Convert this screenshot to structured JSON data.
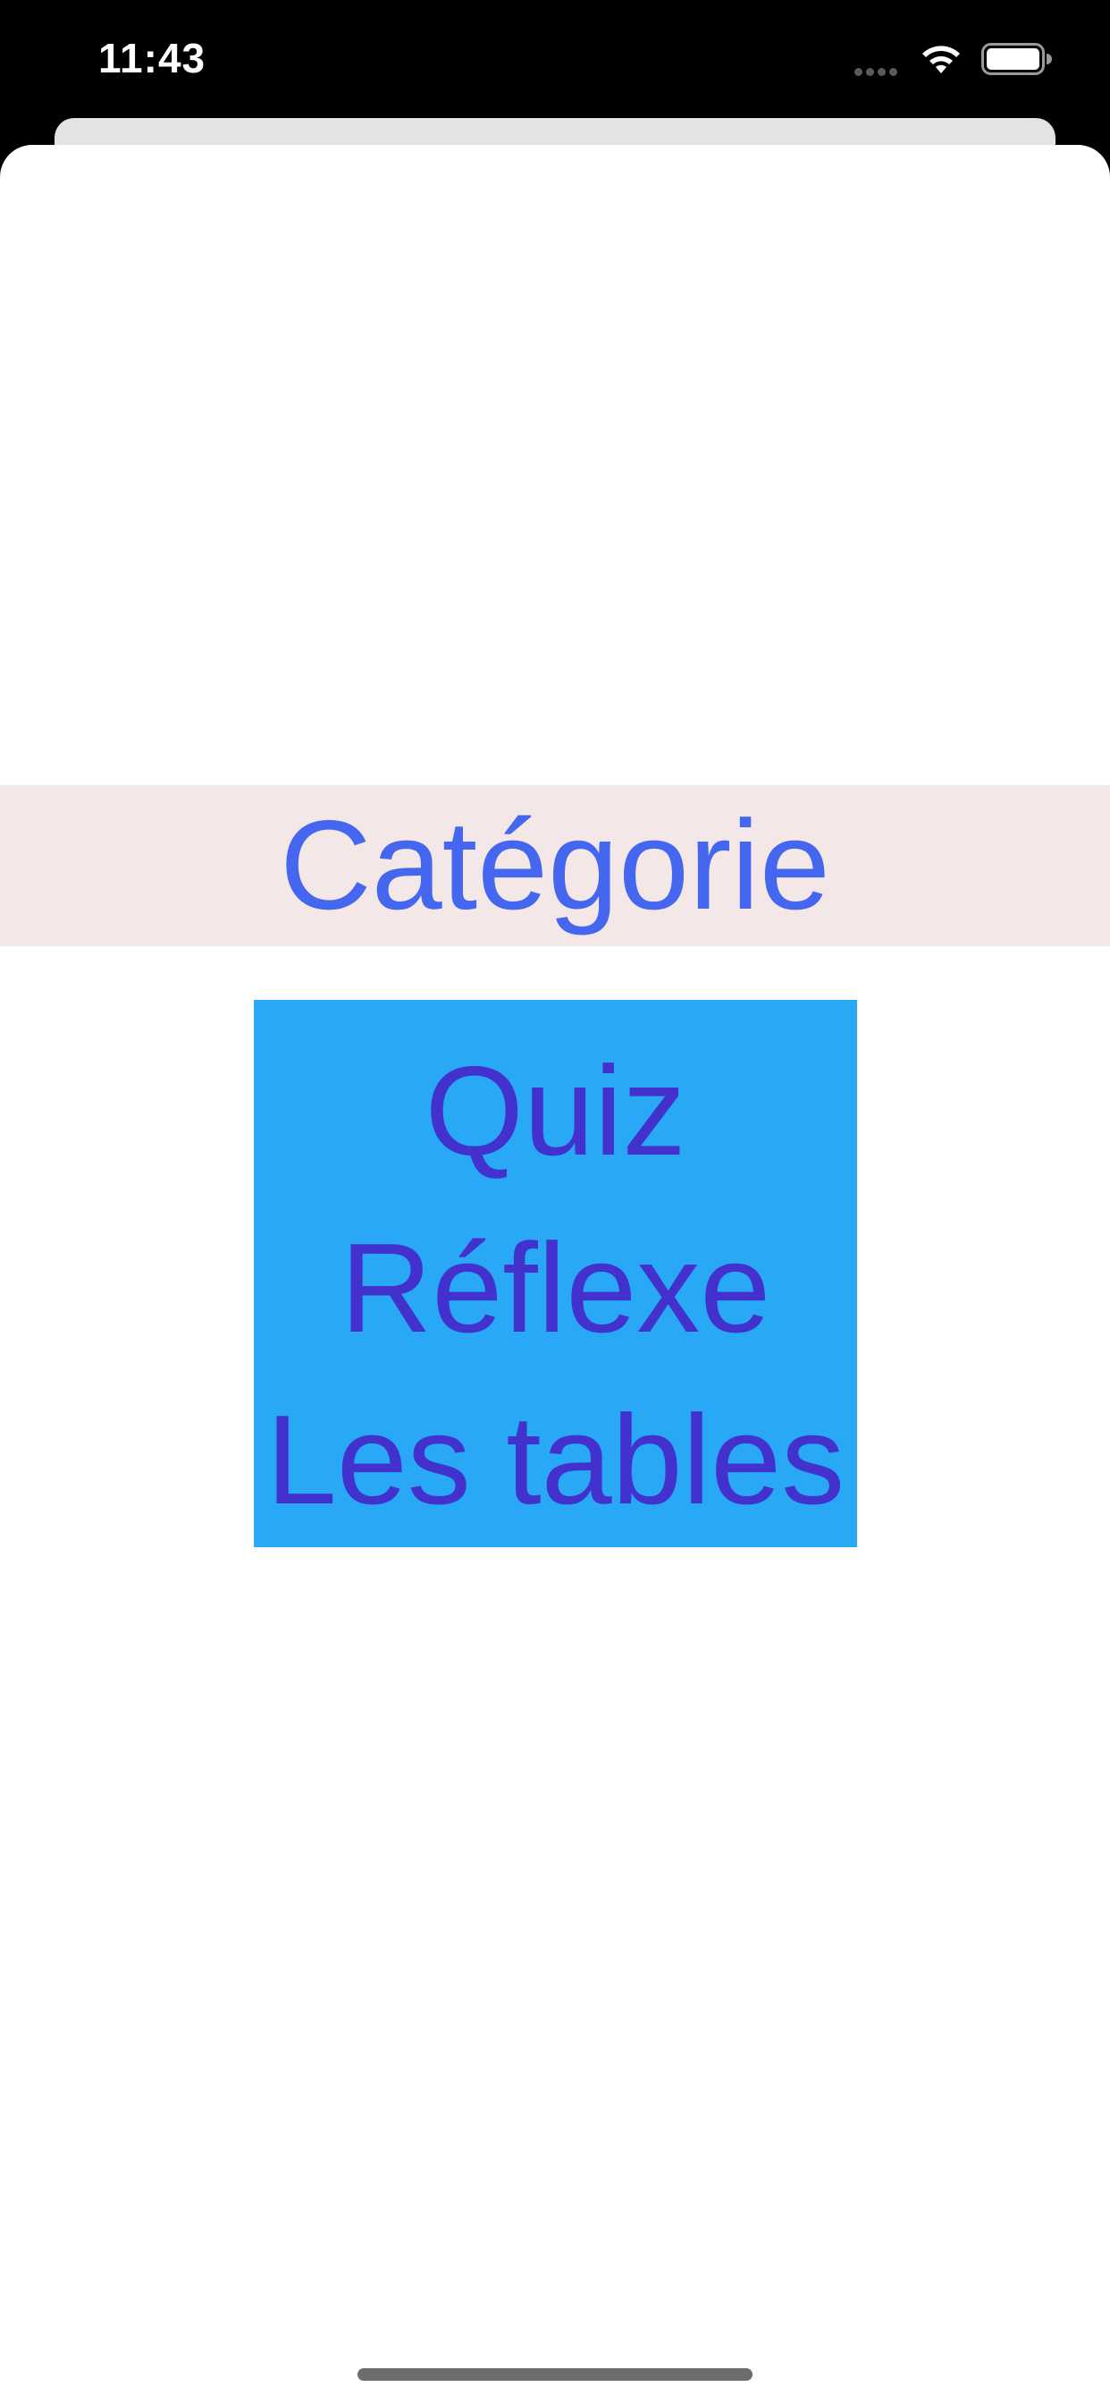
{
  "status_bar": {
    "time": "11:43",
    "icons": [
      "signal-dots-icon",
      "wifi-icon",
      "battery-icon"
    ]
  },
  "header": {
    "title": "Catégorie"
  },
  "menu": {
    "items": [
      {
        "label": "Quiz"
      },
      {
        "label": "Réflexe"
      },
      {
        "label": "Les tables"
      }
    ]
  },
  "colors": {
    "title_text": "#4566ee",
    "header_band": "#f3e7e7",
    "menu_background": "#28a8f5",
    "menu_text": "#4331ce"
  }
}
